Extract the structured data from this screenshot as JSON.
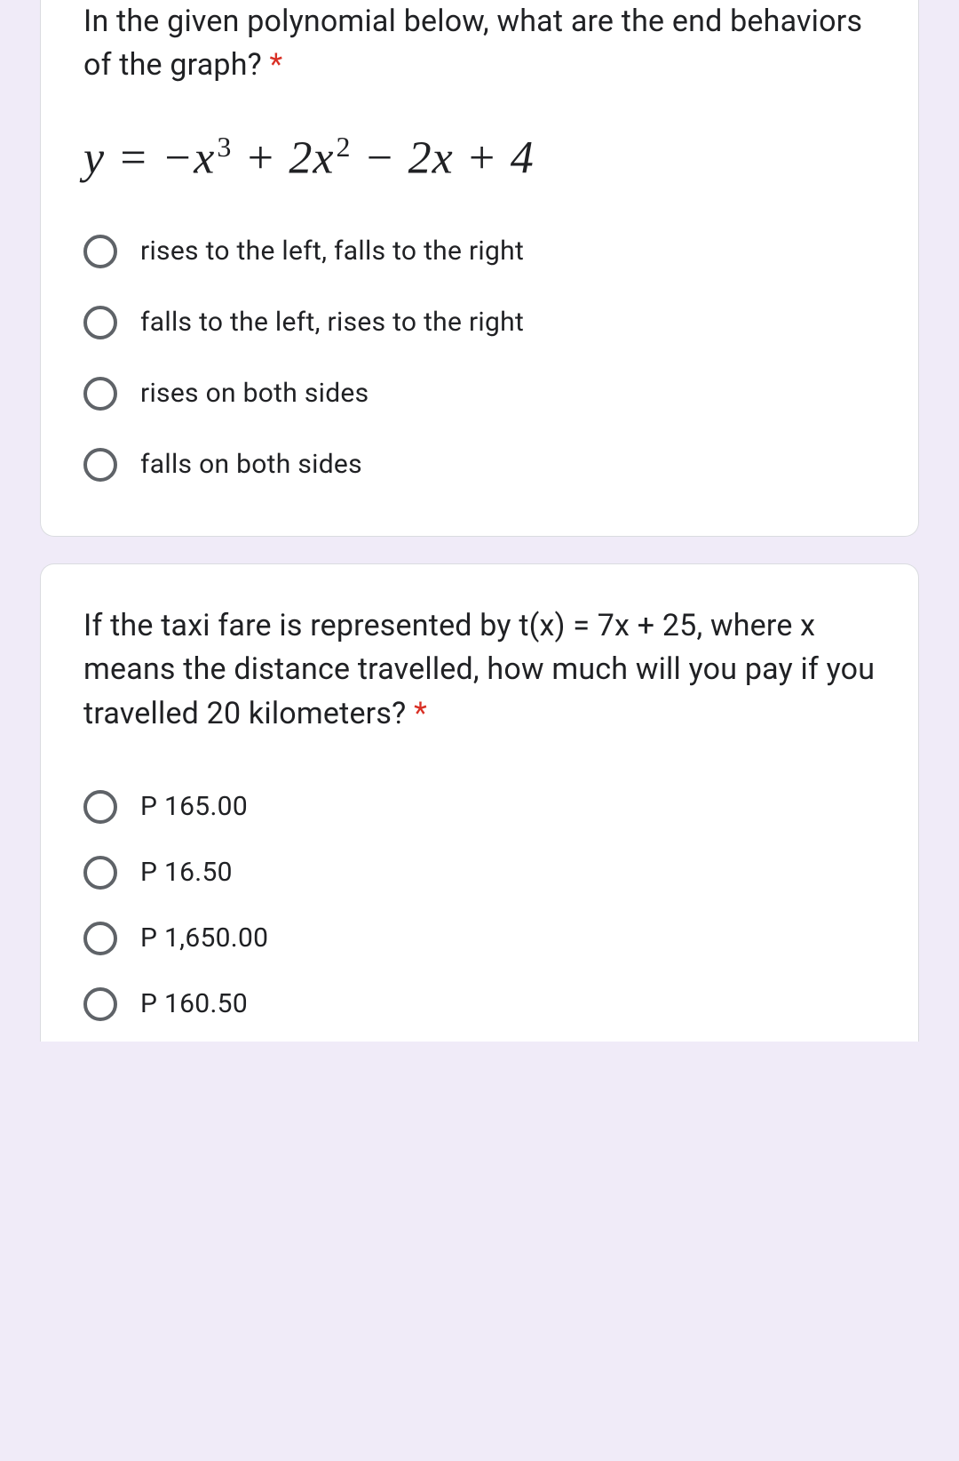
{
  "q1": {
    "title": "In the given polynomial below, what are the end behaviors of the graph? ",
    "required": "*",
    "equation_html": "y = −x<sup>3</sup> + 2x<sup>2</sup> − 2x + 4",
    "options": [
      "rises to the left, falls to the right",
      "falls to the left, rises to the right",
      "rises on both sides",
      "falls on both sides"
    ]
  },
  "q2": {
    "title": "If the taxi fare is represented by t(x) = 7x + 25, where x means the distance travelled, how much will you pay if you travelled 20 kilometers? ",
    "required": "*",
    "options": [
      "P 165.00",
      "P 16.50",
      "P 1,650.00",
      "P 160.50"
    ]
  }
}
